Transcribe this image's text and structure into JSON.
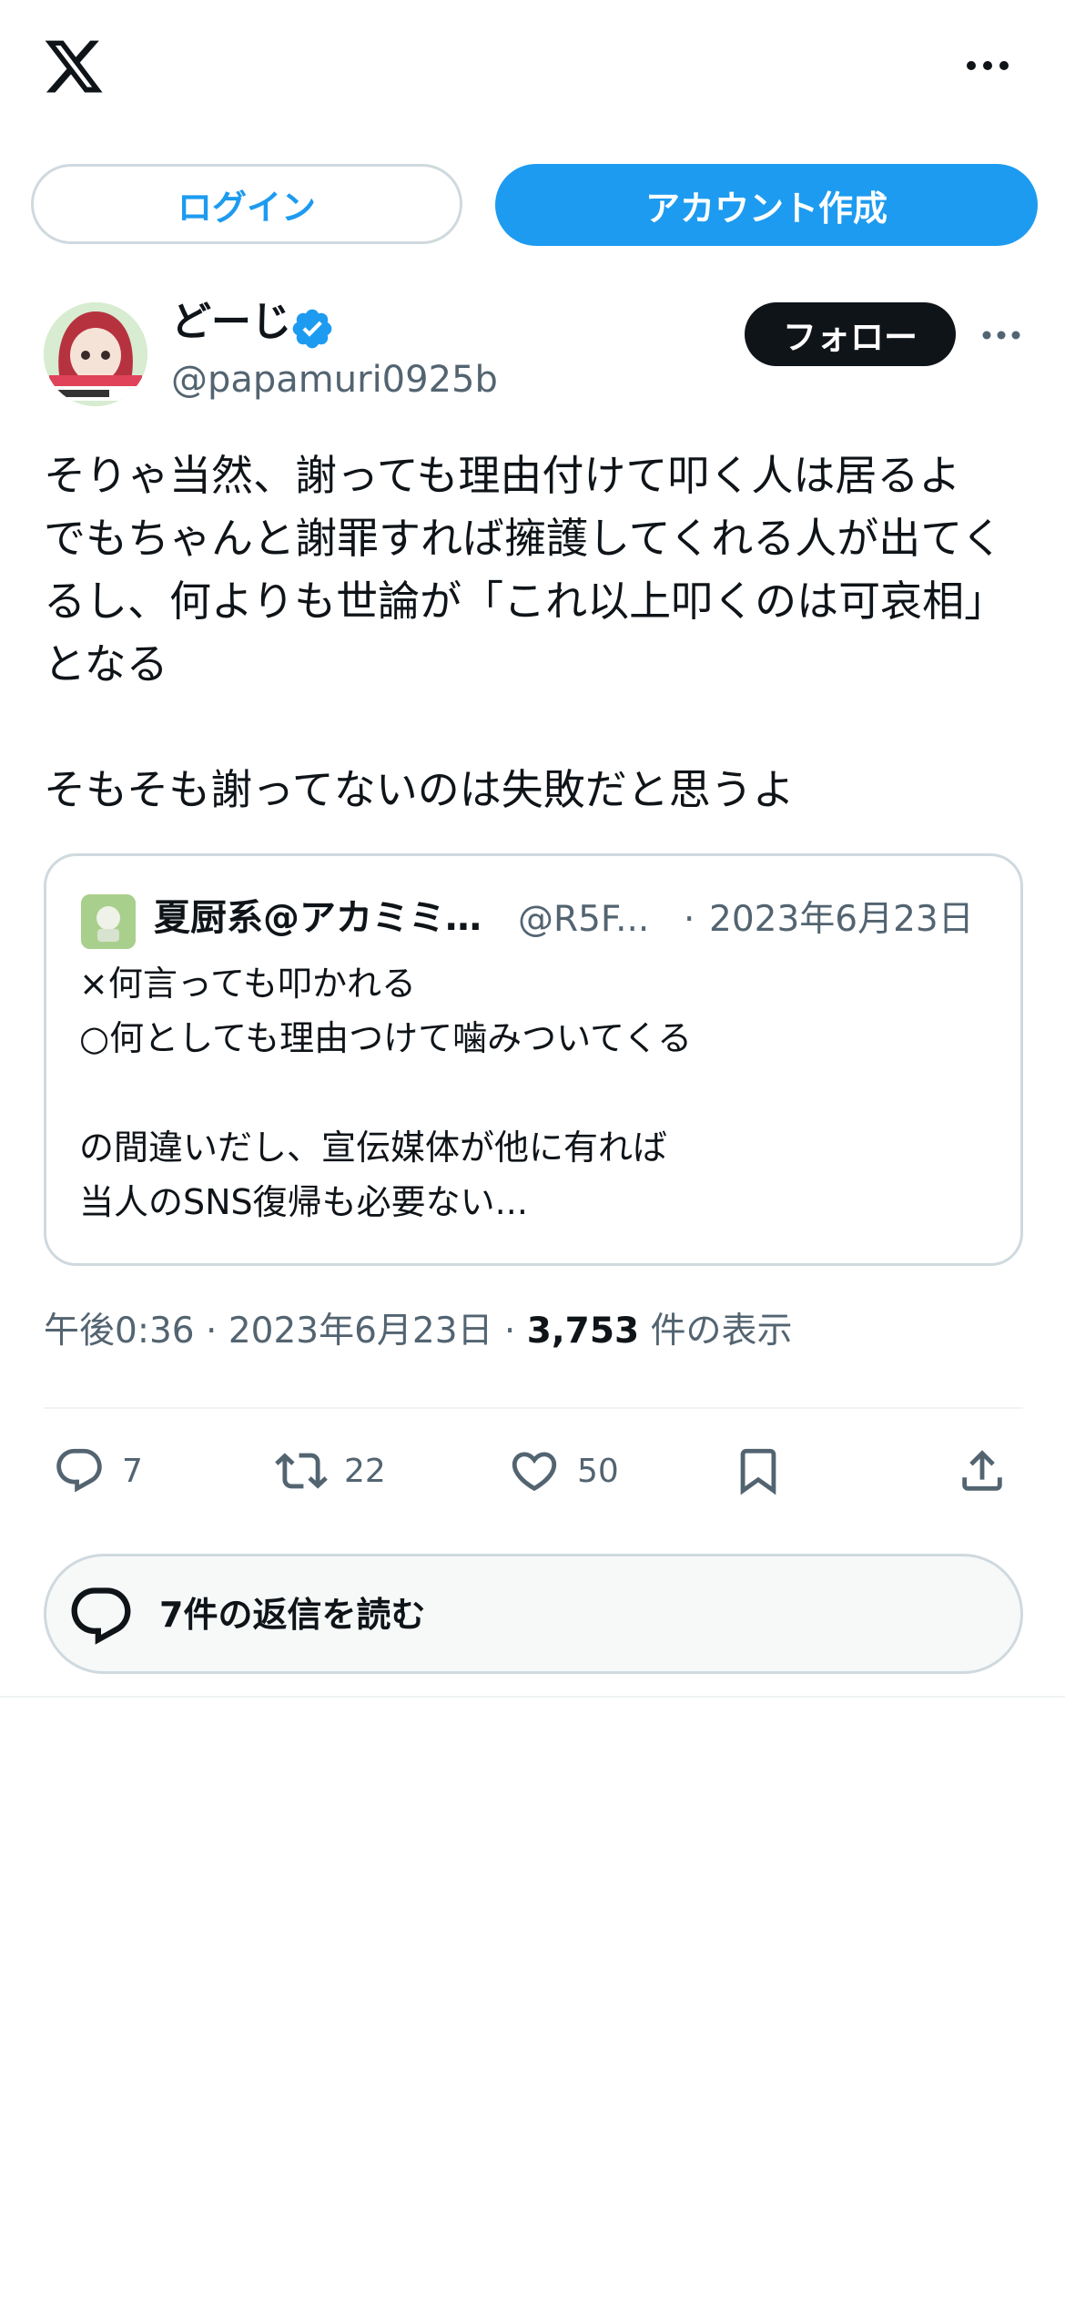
{
  "header": {
    "logo_icon": "x-logo-icon",
    "more_icon": "more-horizontal-icon"
  },
  "auth": {
    "login_label": "ログイン",
    "signup_label": "アカウント作成"
  },
  "tweet": {
    "author_name": "どーじ",
    "verified": true,
    "handle": "@papamuri0925b",
    "follow_label": "フォロー",
    "text": "そりゃ当然、謝っても理由付けて叩く人は居るよ\nでもちゃんと謝罪すれば擁護してくれる人が出てくるし、何よりも世論が「これ以上叩くのは可哀相」となる\n\nそもそも謝ってないのは失敗だと思うよ",
    "time": "午後0:36",
    "date": "2023年6月23日",
    "views_count": "3,753",
    "views_label": "件の表示",
    "separator": "·"
  },
  "quote": {
    "author_name": "夏厨系@アカミミガメ",
    "handle": "@R5F...",
    "separator": "·",
    "date": "2023年6月23日",
    "text": "×何言っても叩かれる\n○何としても理由つけて噛みついてくる\n\nの間違いだし、宣伝媒体が他に有れば\n当人のSNS復帰も必要ない..."
  },
  "actions": {
    "reply_count": "7",
    "retweet_count": "22",
    "like_count": "50"
  },
  "replies": {
    "label": "7件の返信を読む"
  },
  "colors": {
    "accent": "#1d9bf0",
    "text_primary": "#0f1419",
    "text_secondary": "#536471",
    "border": "#cfd9de"
  }
}
